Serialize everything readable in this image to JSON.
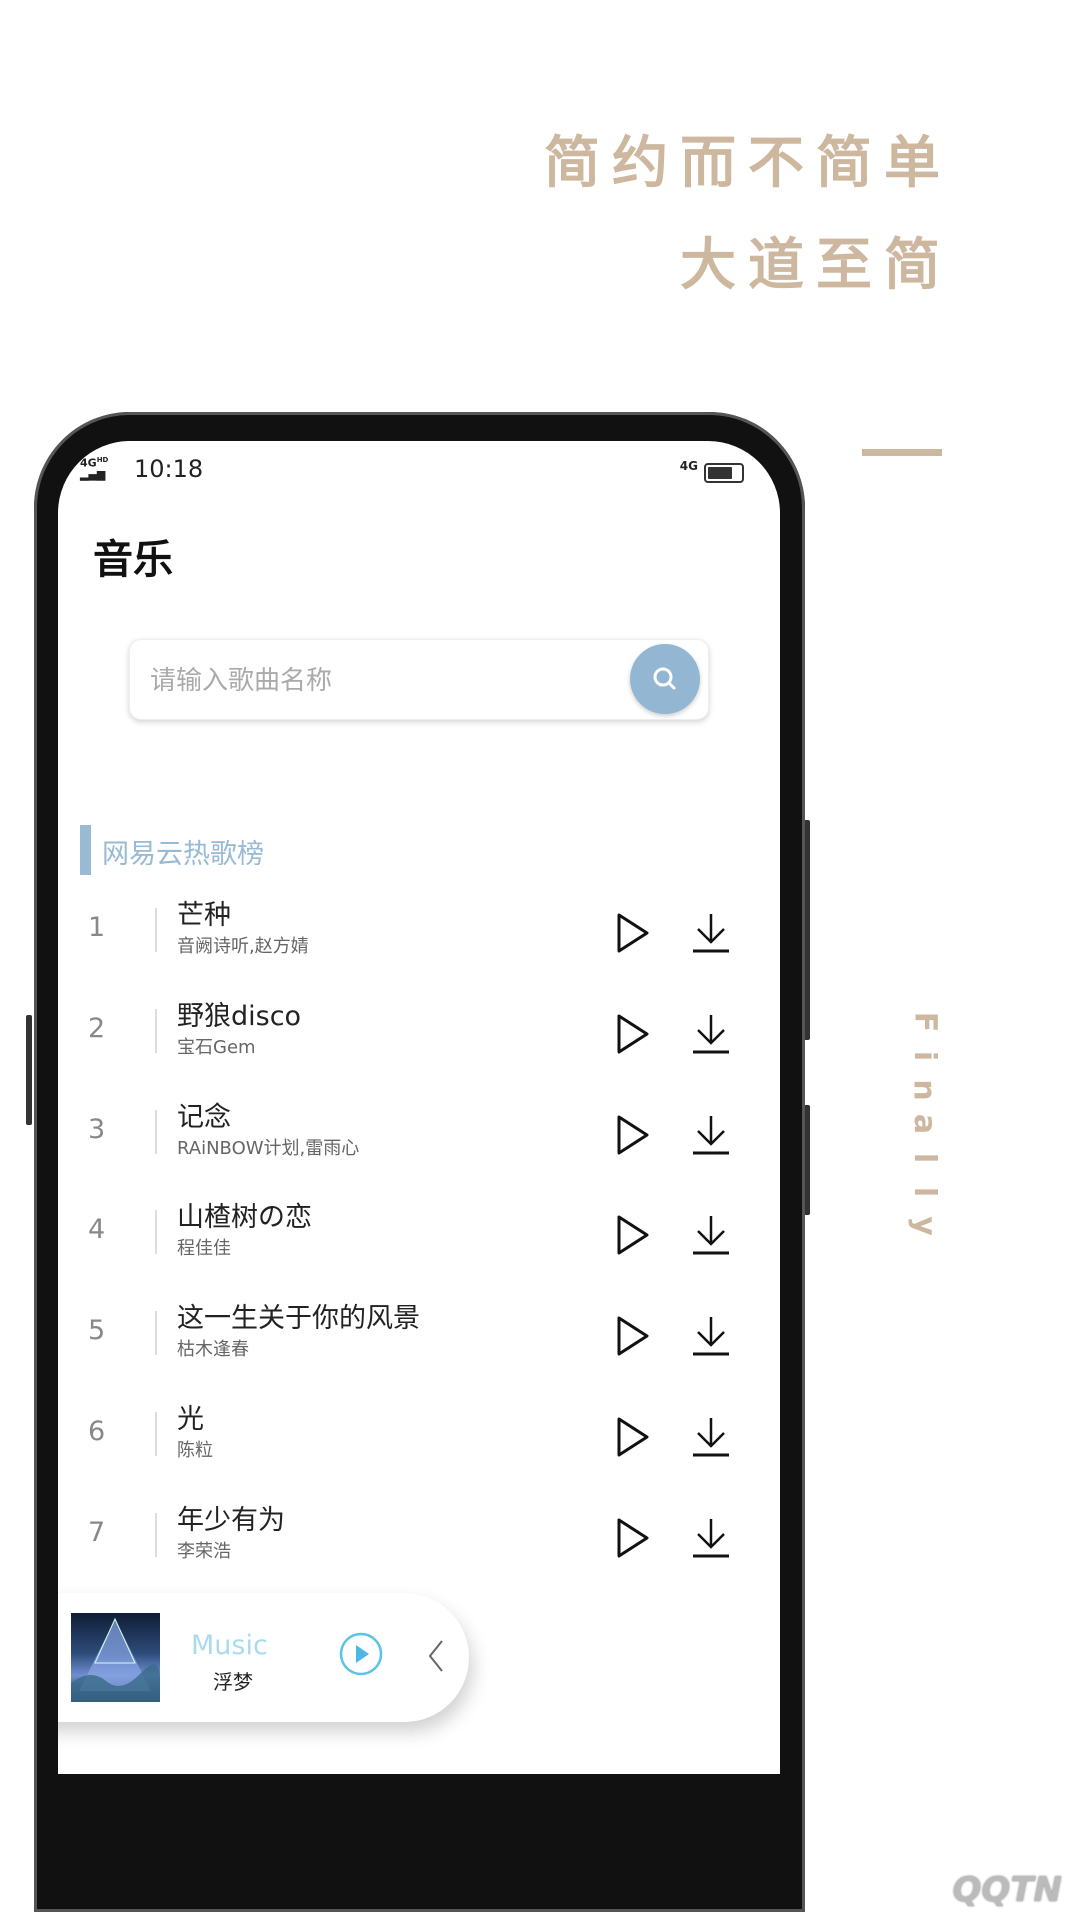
{
  "promo": {
    "headline_line1": "简约而不简单",
    "headline_line2": "大道至简",
    "vertical_word": [
      "F",
      "i",
      "n",
      "a",
      "l",
      "l",
      "y"
    ],
    "accent_color": "#cdb89f"
  },
  "status_bar": {
    "network_left": "4G",
    "network_left_sup": "HD",
    "time": "10:18",
    "network_right": "4G"
  },
  "app": {
    "title": "音乐",
    "search": {
      "placeholder": "请输入歌曲名称",
      "value": "",
      "icon": "search-icon"
    },
    "section_title": "网易云热歌榜",
    "accent_color": "#93b7d3",
    "songs": [
      {
        "rank": "1",
        "title": "芒种",
        "artist": "音阙诗听,赵方婧"
      },
      {
        "rank": "2",
        "title": "野狼disco",
        "artist": "宝石Gem"
      },
      {
        "rank": "3",
        "title": "记念",
        "artist": "RAiNBOW计划,雷雨心"
      },
      {
        "rank": "4",
        "title": "山楂树の恋",
        "artist": "程佳佳"
      },
      {
        "rank": "5",
        "title": "这一生关于你的风景",
        "artist": "枯木逢春"
      },
      {
        "rank": "6",
        "title": "光",
        "artist": "陈粒"
      },
      {
        "rank": "7",
        "title": "年少有为",
        "artist": "李荣浩"
      }
    ],
    "player": {
      "label": "Music",
      "song": "浮梦",
      "play_icon": "play-circle-icon",
      "collapse_icon": "chevron-left-icon"
    }
  },
  "watermark": "QQTN.com"
}
